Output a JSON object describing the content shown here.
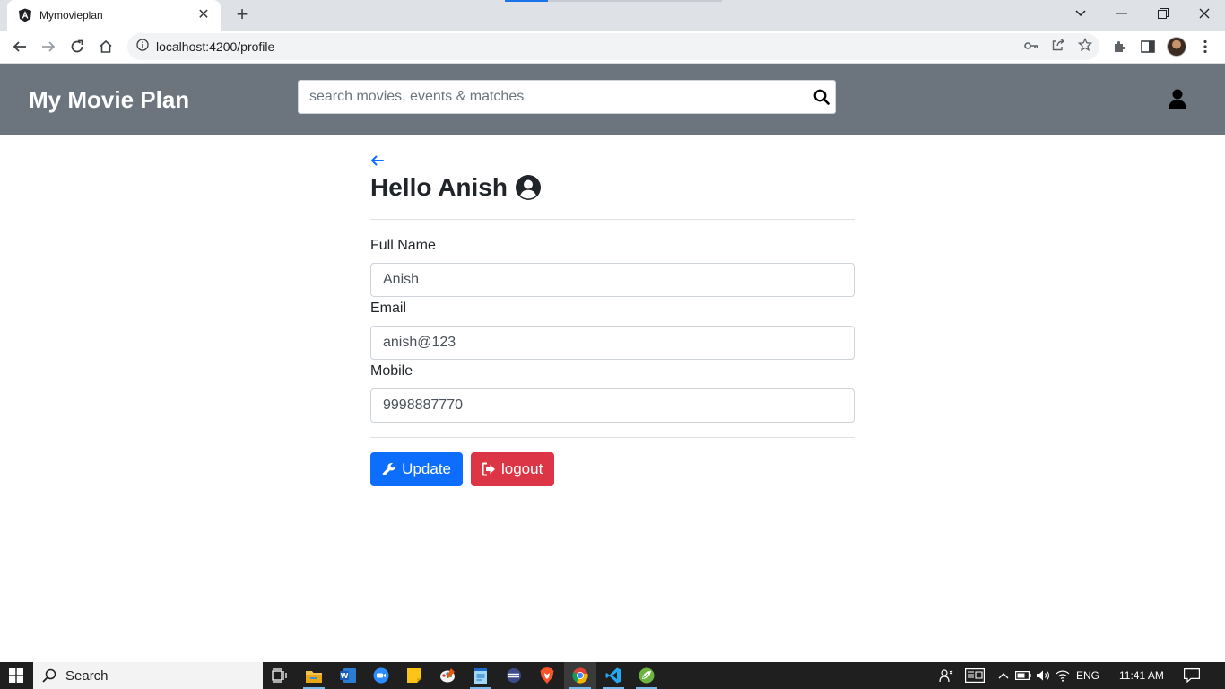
{
  "browser": {
    "tab_title": "Mymovieplan",
    "url": "localhost:4200/profile"
  },
  "app": {
    "brand": "My Movie Plan",
    "search_placeholder": "search movies, events & matches"
  },
  "profile": {
    "greeting": "Hello Anish",
    "fields": {
      "full_name_label": "Full Name",
      "full_name_value": "Anish",
      "email_label": "Email",
      "email_value": "anish@123",
      "mobile_label": "Mobile",
      "mobile_value": "9998887770"
    },
    "update_label": "Update",
    "logout_label": "logout"
  },
  "taskbar": {
    "search_label": "Search",
    "lang": "ENG",
    "time": "11:41 AM"
  },
  "colors": {
    "header_bg": "#6c757d",
    "primary": "#0d6efd",
    "danger": "#dc3545",
    "taskbar_bg": "#1f1f1f"
  }
}
